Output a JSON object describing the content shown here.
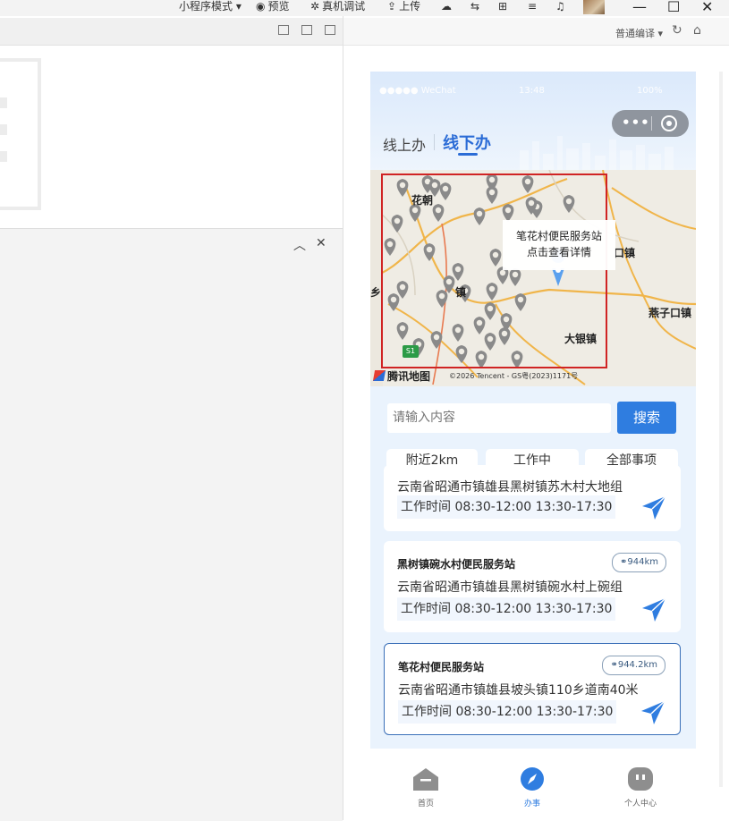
{
  "toolbar": {
    "mode_label": "小程序模式",
    "preview_label": "预览",
    "remote_debug_label": "真机调试",
    "upload_label": "上传"
  },
  "simulator": {
    "compile_label": "普通编译"
  },
  "status_bar": {
    "carrier": "●●●●● WeChat",
    "time": "13:48",
    "battery": "100%"
  },
  "tabs": {
    "online": "线上办",
    "offline": "线下办"
  },
  "map": {
    "places": {
      "huajing": "花朝",
      "town_left": "镇",
      "town_center": "镇",
      "kou": "口镇",
      "yanzikou": "燕子口镇",
      "dayin": "大银镇",
      "xiang": "乡"
    },
    "callout": {
      "title": "笔花村便民服务站",
      "hint": "点击查看详情"
    },
    "logo": "腾讯地图",
    "copyright": "©2026 Tencent - GS粤(2023)1171号",
    "road_badge": "S1"
  },
  "search": {
    "placeholder": "请输入内容",
    "button": "搜索"
  },
  "filters": [
    "附近2km",
    "工作中",
    "全部事项"
  ],
  "stations": [
    {
      "name": "",
      "address": "云南省昭通市镇雄县黑树镇苏木村大地组",
      "hours": "工作时间 08:30-12:00 13:30-17:30",
      "distance": ""
    },
    {
      "name": "黑树镇碗水村便民服务站",
      "address": "云南省昭通市镇雄县黑树镇碗水村上碗组",
      "hours": "工作时间 08:30-12:00 13:30-17:30",
      "distance": "944km"
    },
    {
      "name": "笔花村便民服务站",
      "address": "云南省昭通市镇雄县坡头镇110乡道南40米",
      "hours": "工作时间 08:30-12:00 13:30-17:30",
      "distance": "944.2km"
    }
  ],
  "tabbar": {
    "home": "首页",
    "work": "办事",
    "me": "个人中心"
  },
  "colors": {
    "accent": "#2f7de0",
    "tab_active": "#2b6cd6",
    "highlight_border": "#3a6fb8",
    "map_box": "#d02424"
  }
}
